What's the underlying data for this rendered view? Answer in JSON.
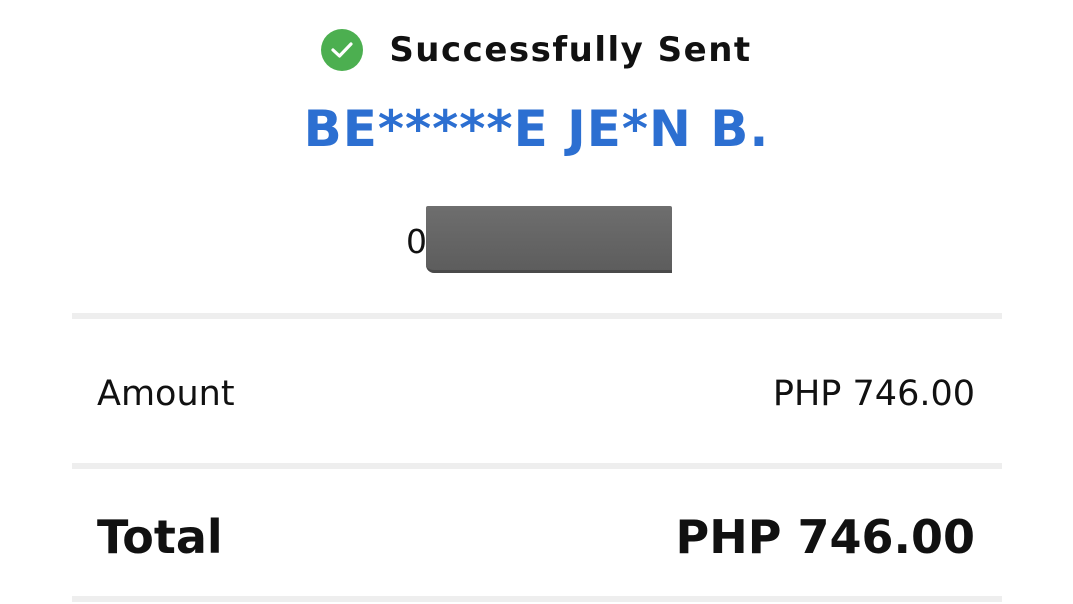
{
  "status": {
    "icon": "check-circle-icon",
    "text": "Successfully Sent",
    "icon_color": "#4CAF50"
  },
  "recipient": {
    "name": "BE*****E JE*N B.",
    "name_color": "#2C6FD1",
    "account_prefix": "0"
  },
  "details": {
    "amount_label": "Amount",
    "amount_value": "PHP 746.00",
    "total_label": "Total",
    "total_value": "PHP 746.00"
  }
}
